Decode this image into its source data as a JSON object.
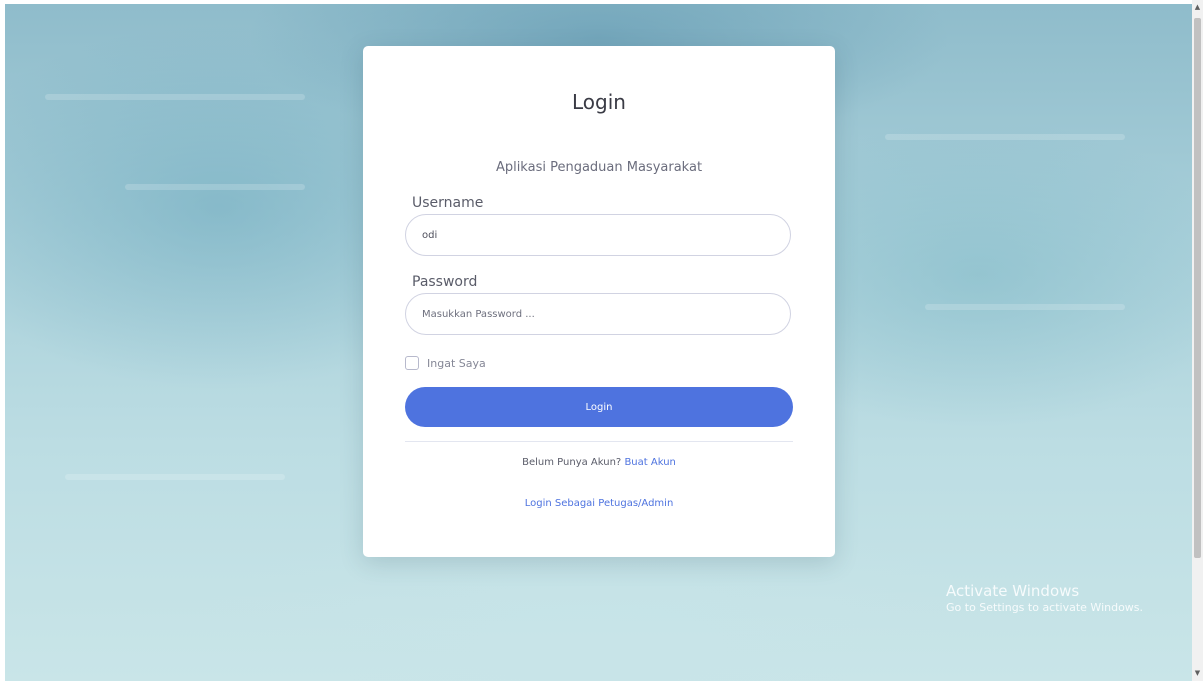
{
  "login_card": {
    "title": "Login",
    "subtitle": "Aplikasi Pengaduan Masyarakat",
    "username": {
      "label": "Username",
      "value": "odi"
    },
    "password": {
      "label": "Password",
      "placeholder": "Masukkan Password ..."
    },
    "remember": {
      "label": "Ingat Saya",
      "checked": false
    },
    "login_button_label": "Login",
    "register": {
      "prompt": "Belum Punya Akun?",
      "link_label": "Buat Akun"
    },
    "admin_link_label": "Login Sebagai Petugas/Admin"
  },
  "watermark": {
    "title": "Activate Windows",
    "subtitle": "Go to Settings to activate Windows."
  },
  "colors": {
    "primary": "#4e73df",
    "card_background": "#ffffff",
    "text_dark": "#3a3b45",
    "text_muted": "#858796"
  },
  "icons": {
    "scroll_up": "▲",
    "scroll_down": "▼"
  }
}
